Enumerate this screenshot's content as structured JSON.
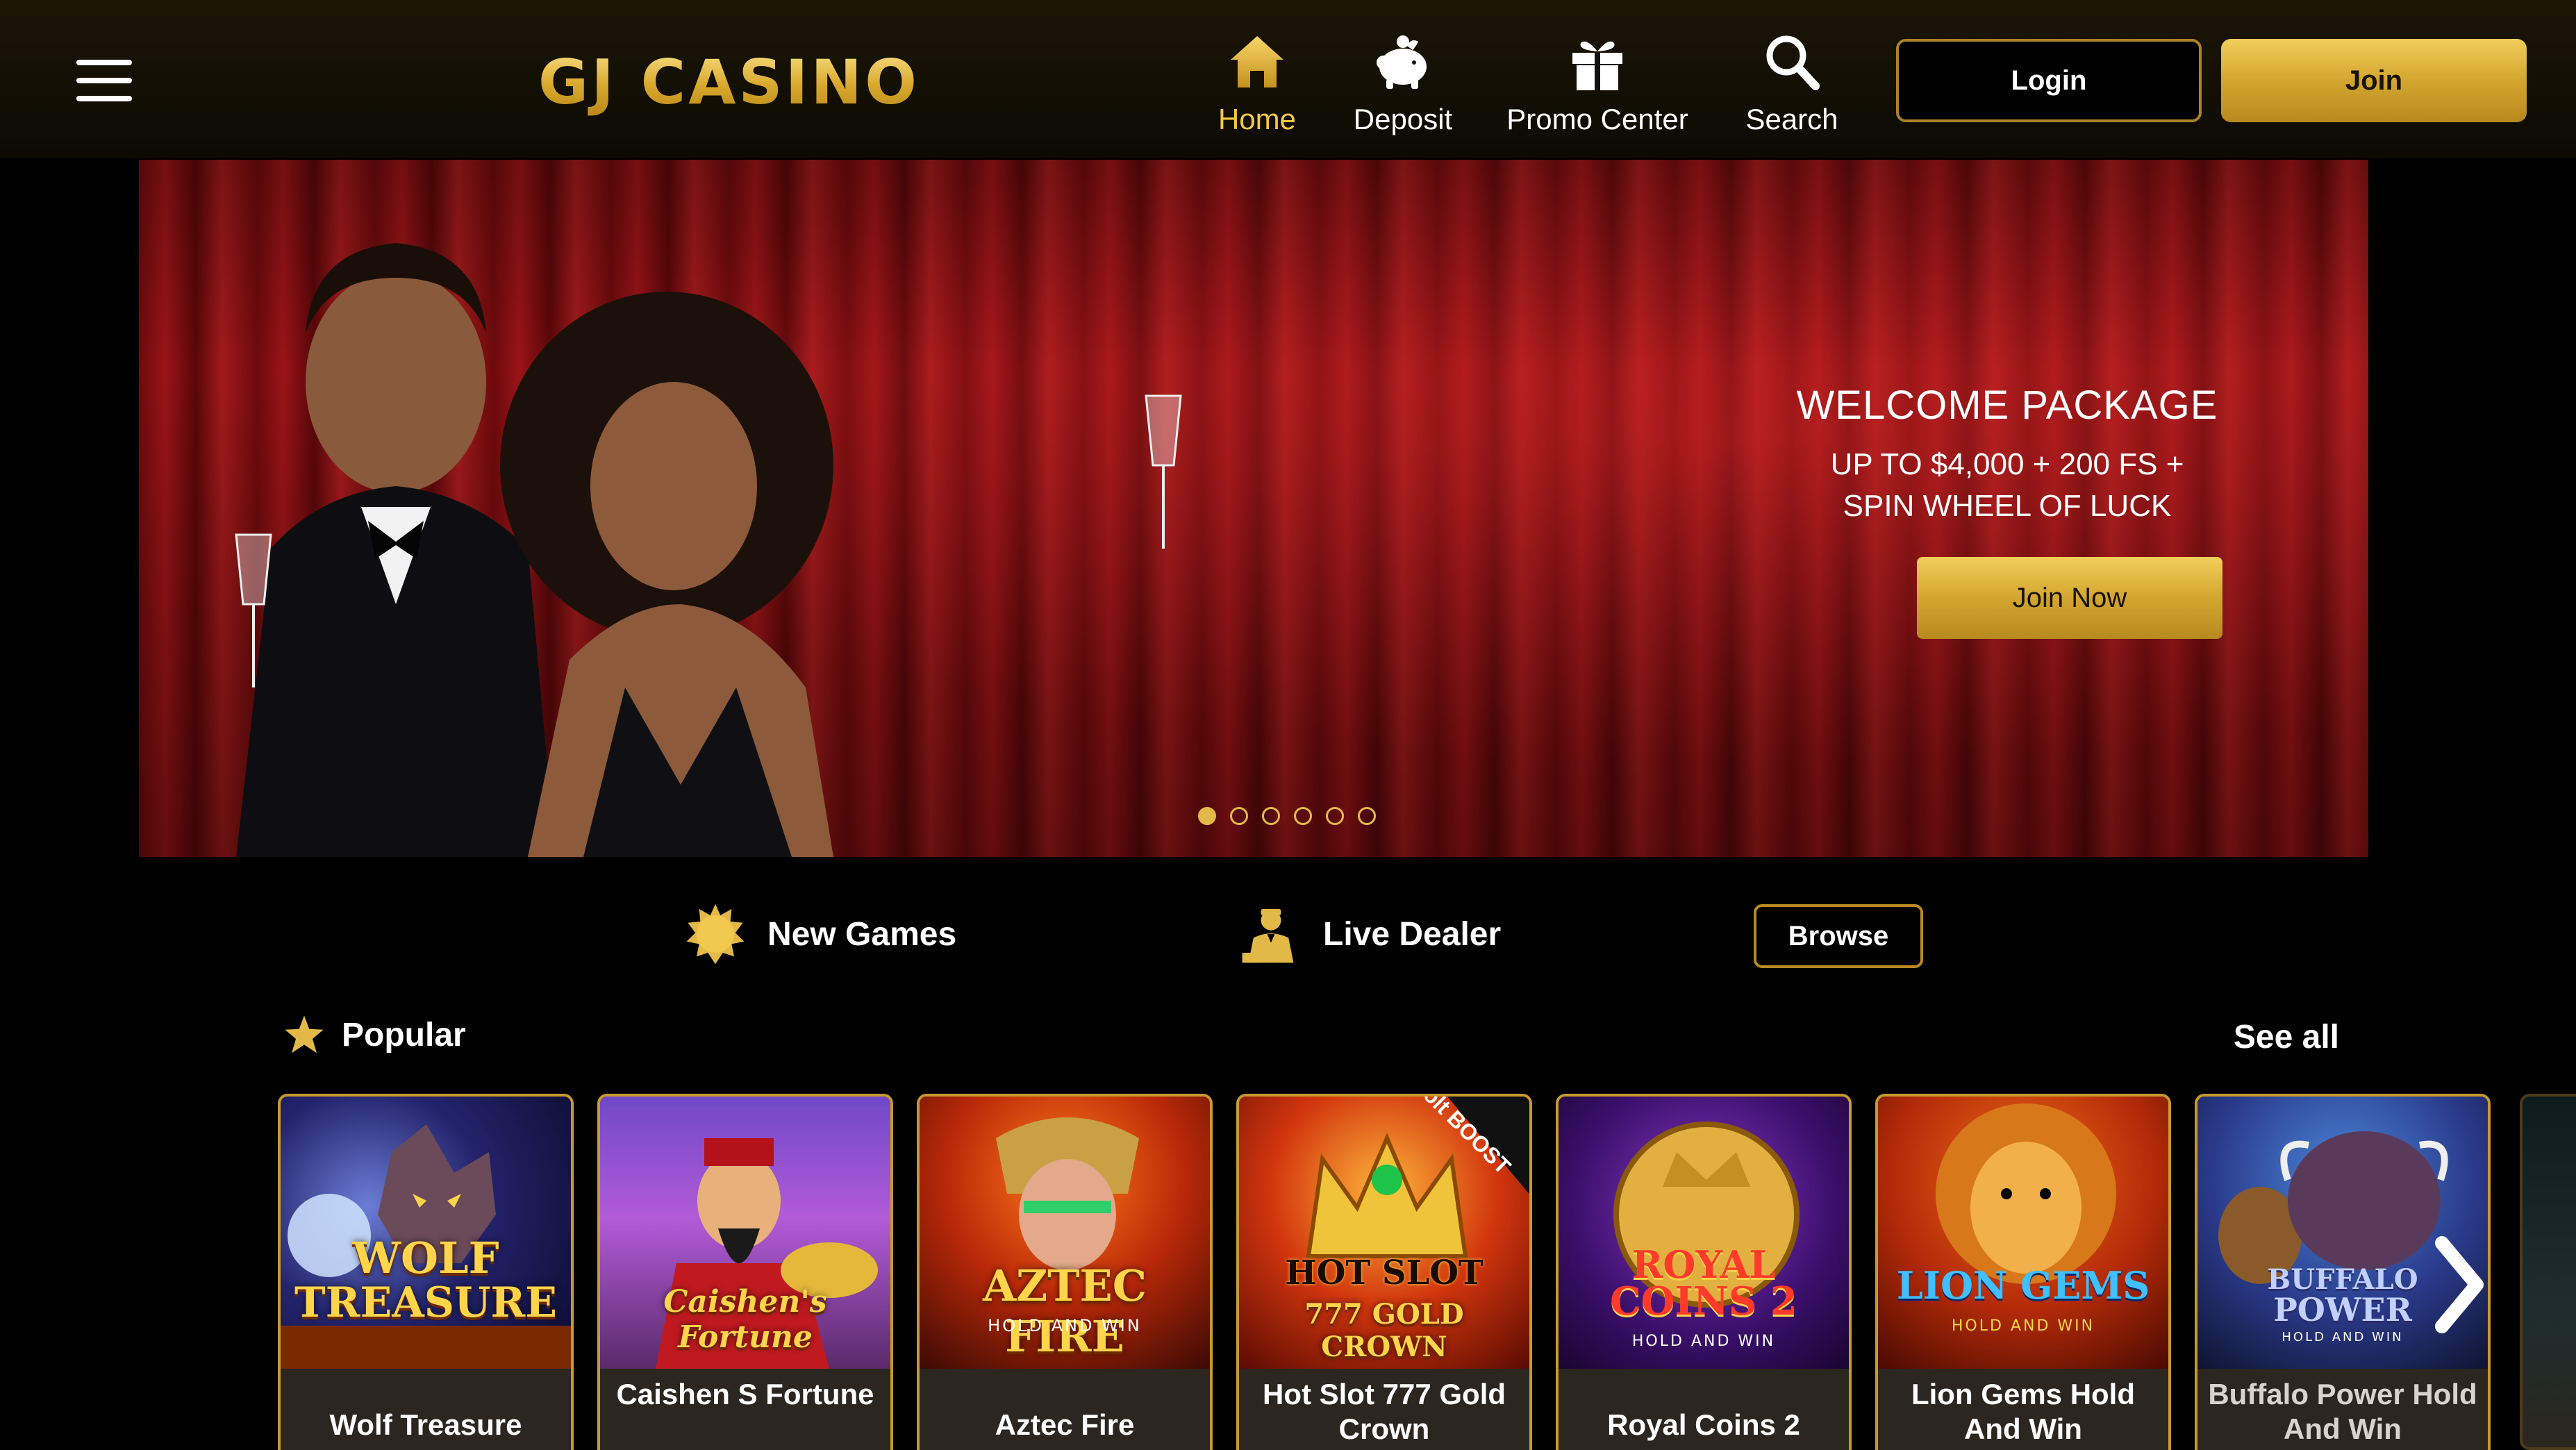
{
  "header": {
    "logo_text": "GJ CASINO",
    "nav": [
      {
        "label": "Home",
        "icon": "home-icon",
        "active": true
      },
      {
        "label": "Deposit",
        "icon": "piggy-bank-icon",
        "active": false
      },
      {
        "label": "Promo Center",
        "icon": "gift-icon",
        "active": false
      },
      {
        "label": "Search",
        "icon": "search-icon",
        "active": false
      }
    ],
    "login_label": "Login",
    "join_label": "Join"
  },
  "hero": {
    "title": "WELCOME PACKAGE",
    "subtitle_line1": "UP TO $4,000 + 200 FS +",
    "subtitle_line2": "SPIN WHEEL OF LUCK",
    "cta_label": "Join Now",
    "slide_count": 6,
    "active_slide": 1
  },
  "categories": {
    "new_games_label": "New Games",
    "live_dealer_label": "Live Dealer",
    "browse_label": "Browse"
  },
  "popular": {
    "title": "Popular",
    "see_all_label": "See all",
    "games": [
      {
        "name": "Wolf Treasure",
        "art_line1": "WOLF",
        "art_line2": "TREASURE",
        "art_sub": ""
      },
      {
        "name": "Caishen S Fortune",
        "art_line1": "Caishen's Fortune",
        "art_line2": "",
        "art_sub": ""
      },
      {
        "name": "Aztec Fire",
        "art_line1": "AZTEC FIRE",
        "art_line2": "",
        "art_sub": "HOLD AND WIN"
      },
      {
        "name": "Hot Slot 777 Gold Crown",
        "art_line1": "HOT SLOT",
        "art_line2": "777 GOLD CROWN",
        "art_sub": "",
        "badge": "Volt BOOST"
      },
      {
        "name": "Royal Coins 2",
        "art_line1": "ROYAL",
        "art_line2": "COINS 2",
        "art_sub": "HOLD AND WIN"
      },
      {
        "name": "Lion Gems Hold And Win",
        "art_line1": "LION GEMS",
        "art_line2": "",
        "art_sub": "HOLD AND WIN"
      },
      {
        "name": "Buffalo Power Hold And Win",
        "art_line1": "BUFFALO",
        "art_line2": "POWER",
        "art_sub": "HOLD AND WIN"
      }
    ]
  },
  "colors": {
    "gold": "#e2b948",
    "gold_dark": "#b88a1f",
    "header_bg": "#120e04",
    "page_bg": "#000000",
    "active_nav": "#f3c843"
  }
}
